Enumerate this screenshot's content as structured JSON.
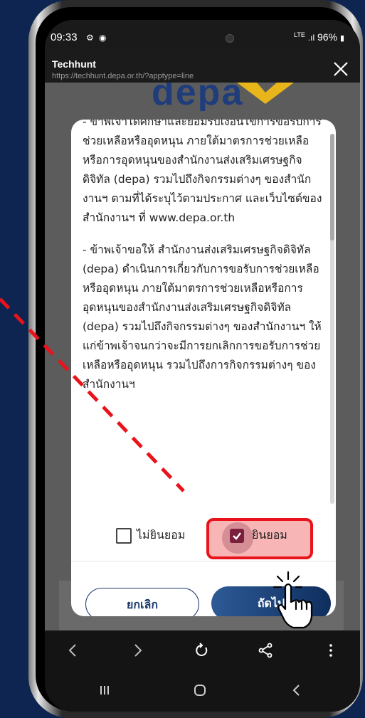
{
  "status_bar": {
    "time": "09:33",
    "network": "LTE",
    "battery": "96%"
  },
  "app_header": {
    "title": "Techhunt",
    "url": "https://techhunt.depa.or.th/?apptype=line"
  },
  "logo": {
    "text": "depa"
  },
  "terms": {
    "paragraph_1": "- ข้าพเจ้าได้ศึกษาและยอมรับเงื่อนไขการขอรับการช่วยเหลือหรืออุดหนุน ภายใต้มาตรการช่วยเหลือหรือการอุดหนุนของสำนักงานส่งเสริมเศรษฐกิจดิจิทัล (depa) รวมไปถึงกิจกรรมต่างๆ ของสำนักงานฯ ตามที่ได้ระบุไว้ตามประกาศ และเว็บไซต์ของสำนักงานฯ ที่ www.depa.or.th",
    "paragraph_2": "- ข้าพเจ้าขอให้ สำนักงานส่งเสริมเศรษฐกิจดิจิทัล (depa) ดำเนินการเกี่ยวกับการขอรับการช่วยเหลือหรืออุดหนุน ภายใต้มาตรการช่วยเหลือหรือการอุดหนุนของสำนักงานส่งเสริมเศรษฐกิจดิจิทัล (depa) รวมไปถึงกิจกรรมต่างๆ ของสำนักงานฯ ให้แก่ข้าพเจ้าจนกว่าจะมีการยกเลิกการขอรับการช่วยเหลือหรืออุดหนุน รวมไปถึงการกิจกรรมต่างๆ ของสำนักงานฯ"
  },
  "consent": {
    "decline_label": "ไม่ยินยอม",
    "accept_label": "ยินยอม",
    "accept_checked": true
  },
  "buttons": {
    "cancel": "ยกเลิก",
    "next": "ถัดไป"
  },
  "colors": {
    "background": "#0d2550",
    "highlight_border": "#e8131b",
    "arrow": "#e8131b",
    "button_primary": "#1e3a6b",
    "checkbox_checked": "#7a1f3c"
  },
  "icons": {
    "browser_nav": [
      "back-icon",
      "forward-icon",
      "refresh-icon",
      "share-icon",
      "more-icon"
    ],
    "system_nav": [
      "recents-icon",
      "home-icon",
      "system-back-icon"
    ]
  }
}
